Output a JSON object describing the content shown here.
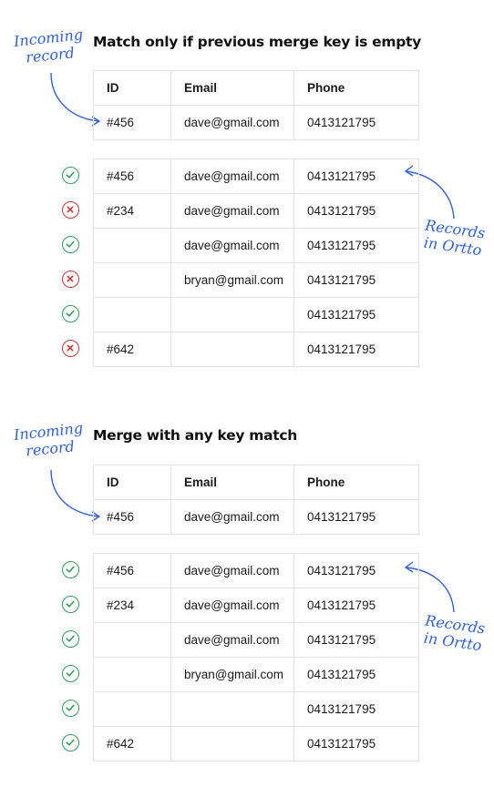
{
  "colors": {
    "accent_blue": "#2f5fd9",
    "ok_green": "#2f9e5b",
    "bad_red": "#c8363a",
    "border": "#e2e2e2"
  },
  "sections": [
    {
      "title": "Match only if previous merge key is empty",
      "incoming_annotation": [
        "Incoming",
        "record"
      ],
      "records_annotation": [
        "Records",
        "in Ortto"
      ],
      "headers": [
        "ID",
        "Email",
        "Phone"
      ],
      "incoming": {
        "id": "#456",
        "email": "dave@gmail.com",
        "phone": "0413121795"
      },
      "records": [
        {
          "status": "match",
          "icon": "check-circle-icon",
          "id": "#456",
          "email": "dave@gmail.com",
          "phone": "0413121795"
        },
        {
          "status": "no-match",
          "icon": "x-circle-icon",
          "id": "#234",
          "email": "dave@gmail.com",
          "phone": "0413121795"
        },
        {
          "status": "match",
          "icon": "check-circle-icon",
          "id": "",
          "email": "dave@gmail.com",
          "phone": "0413121795"
        },
        {
          "status": "no-match",
          "icon": "x-circle-icon",
          "id": "",
          "email": "bryan@gmail.com",
          "phone": "0413121795"
        },
        {
          "status": "match",
          "icon": "check-circle-icon",
          "id": "",
          "email": "",
          "phone": "0413121795"
        },
        {
          "status": "no-match",
          "icon": "x-circle-icon",
          "id": "#642",
          "email": "",
          "phone": "0413121795"
        }
      ]
    },
    {
      "title": "Merge with any key match",
      "incoming_annotation": [
        "Incoming",
        "record"
      ],
      "records_annotation": [
        "Records",
        "in Ortto"
      ],
      "headers": [
        "ID",
        "Email",
        "Phone"
      ],
      "incoming": {
        "id": "#456",
        "email": "dave@gmail.com",
        "phone": "0413121795"
      },
      "records": [
        {
          "status": "match",
          "icon": "check-circle-icon",
          "id": "#456",
          "email": "dave@gmail.com",
          "phone": "0413121795"
        },
        {
          "status": "match",
          "icon": "check-circle-icon",
          "id": "#234",
          "email": "dave@gmail.com",
          "phone": "0413121795"
        },
        {
          "status": "match",
          "icon": "check-circle-icon",
          "id": "",
          "email": "dave@gmail.com",
          "phone": "0413121795"
        },
        {
          "status": "match",
          "icon": "check-circle-icon",
          "id": "",
          "email": "bryan@gmail.com",
          "phone": "0413121795"
        },
        {
          "status": "match",
          "icon": "check-circle-icon",
          "id": "",
          "email": "",
          "phone": "0413121795"
        },
        {
          "status": "match",
          "icon": "check-circle-icon",
          "id": "#642",
          "email": "",
          "phone": "0413121795"
        }
      ]
    }
  ]
}
